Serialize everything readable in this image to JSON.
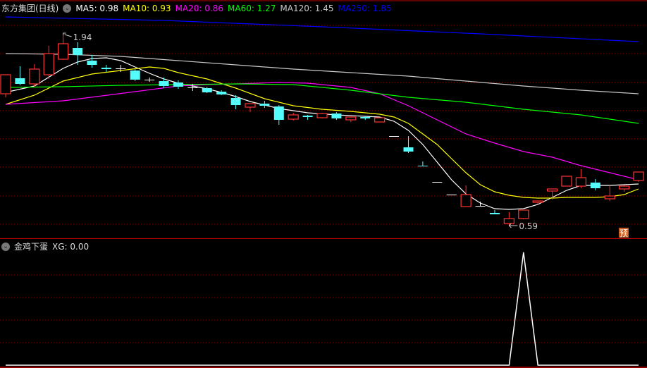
{
  "header": {
    "title": "东方集团(日线)",
    "ma_items": [
      {
        "label": "MA5: 0.98",
        "color": "#ffffff"
      },
      {
        "label": "MA10: 0.93",
        "color": "#ffff00"
      },
      {
        "label": "MA20: 0.86",
        "color": "#ff00ff"
      },
      {
        "label": "MA60: 1.27",
        "color": "#00ff00"
      },
      {
        "label": "MA120: 1.45",
        "color": "#c8c8c8"
      },
      {
        "label": "MA250: 1.85",
        "color": "#0000ff"
      }
    ]
  },
  "indicator": {
    "title": "金鸡下蛋",
    "value_label": "XG: 0.00"
  },
  "annotations": {
    "high_label": "1.94",
    "low_label": "0.59",
    "badge": "预"
  },
  "colors": {
    "up": "#ff3232",
    "down": "#54fcfc",
    "flat": "#ffffff",
    "grid": "#8b0000",
    "border": "#c00000"
  },
  "chart_data": [
    {
      "type": "candlestick",
      "title": "东方集团(日线)",
      "ylim": [
        0.5,
        2.19
      ],
      "ohlc": [
        [
          1.525,
          1.66,
          1.5,
          1.66
        ],
        [
          1.635,
          1.72,
          1.585,
          1.595
        ],
        [
          1.595,
          1.735,
          1.575,
          1.7
        ],
        [
          1.66,
          1.865,
          1.63,
          1.81
        ],
        [
          1.77,
          1.94,
          1.765,
          1.88
        ],
        [
          1.85,
          1.89,
          1.73,
          1.8
        ],
        [
          1.76,
          1.8,
          1.71,
          1.73
        ],
        [
          1.71,
          1.73,
          1.68,
          1.7
        ],
        [
          1.705,
          1.73,
          1.68,
          1.705
        ],
        [
          1.69,
          1.7,
          1.615,
          1.625
        ],
        [
          1.625,
          1.64,
          1.61,
          1.625
        ],
        [
          1.615,
          1.64,
          1.565,
          1.58
        ],
        [
          1.605,
          1.62,
          1.56,
          1.575
        ],
        [
          1.57,
          1.595,
          1.545,
          1.57
        ],
        [
          1.565,
          1.575,
          1.53,
          1.535
        ],
        [
          1.54,
          1.55,
          1.515,
          1.52
        ],
        [
          1.495,
          1.515,
          1.415,
          1.445
        ],
        [
          1.43,
          1.455,
          1.395,
          1.455
        ],
        [
          1.455,
          1.475,
          1.425,
          1.44
        ],
        [
          1.435,
          1.445,
          1.305,
          1.34
        ],
        [
          1.345,
          1.39,
          1.335,
          1.375
        ],
        [
          1.37,
          1.375,
          1.34,
          1.36
        ],
        [
          1.355,
          1.39,
          1.35,
          1.385
        ],
        [
          1.385,
          1.395,
          1.34,
          1.35
        ],
        [
          1.34,
          1.37,
          1.325,
          1.36
        ],
        [
          1.36,
          1.365,
          1.34,
          1.35
        ],
        [
          1.325,
          1.355,
          1.325,
          1.355
        ],
        [
          1.225,
          1.225,
          1.225,
          1.225
        ],
        [
          1.145,
          1.225,
          1.105,
          1.115
        ],
        [
          1.015,
          1.045,
          1.01,
          1.01
        ],
        [
          0.9,
          0.9,
          0.9,
          0.9
        ],
        [
          0.81,
          0.81,
          0.81,
          0.81
        ],
        [
          0.725,
          0.875,
          0.725,
          0.81
        ],
        [
          0.73,
          0.76,
          0.73,
          0.73
        ],
        [
          0.68,
          0.7,
          0.67,
          0.67
        ],
        [
          0.605,
          0.685,
          0.59,
          0.64
        ],
        [
          0.64,
          0.7,
          0.635,
          0.7
        ],
        [
          0.755,
          0.765,
          0.74,
          0.765
        ],
        [
          0.835,
          0.85,
          0.775,
          0.85
        ],
        [
          0.87,
          0.94,
          0.87,
          0.94
        ],
        [
          0.87,
          0.99,
          0.855,
          0.93
        ],
        [
          0.895,
          0.92,
          0.84,
          0.855
        ],
        [
          0.78,
          0.875,
          0.765,
          0.8
        ],
        [
          0.85,
          0.875,
          0.83,
          0.87
        ],
        [
          0.91,
          0.97,
          0.9,
          0.97
        ]
      ],
      "series": [
        {
          "name": "MA5",
          "color": "#ffffff",
          "points": [
            [
              1,
              1.535
            ],
            [
              3,
              1.58
            ],
            [
              5,
              1.705
            ],
            [
              6,
              1.75
            ],
            [
              7,
              1.775
            ],
            [
              8,
              1.78
            ],
            [
              9,
              1.76
            ],
            [
              10,
              1.715
            ],
            [
              11,
              1.67
            ],
            [
              12,
              1.63
            ],
            [
              13,
              1.6
            ],
            [
              14,
              1.58
            ],
            [
              15,
              1.56
            ],
            [
              16,
              1.535
            ],
            [
              17,
              1.505
            ],
            [
              18,
              1.47
            ],
            [
              19,
              1.445
            ],
            [
              20,
              1.42
            ],
            [
              22,
              1.39
            ],
            [
              24,
              1.375
            ],
            [
              26,
              1.365
            ],
            [
              27,
              1.36
            ],
            [
              28,
              1.33
            ],
            [
              29,
              1.265
            ],
            [
              30,
              1.165
            ],
            [
              31,
              1.04
            ],
            [
              32,
              0.915
            ],
            [
              33,
              0.815
            ],
            [
              34,
              0.75
            ],
            [
              35,
              0.71
            ],
            [
              36,
              0.705
            ],
            [
              37,
              0.71
            ],
            [
              38,
              0.74
            ],
            [
              39,
              0.79
            ],
            [
              40,
              0.84
            ],
            [
              41,
              0.875
            ],
            [
              42,
              0.875
            ],
            [
              43,
              0.875
            ],
            [
              44,
              0.88
            ],
            [
              45,
              0.885
            ]
          ]
        },
        {
          "name": "MA10",
          "color": "#ffff00",
          "points": [
            [
              1,
              1.45
            ],
            [
              3,
              1.515
            ],
            [
              5,
              1.615
            ],
            [
              7,
              1.665
            ],
            [
              9,
              1.69
            ],
            [
              11,
              1.715
            ],
            [
              12,
              1.705
            ],
            [
              13,
              1.675
            ],
            [
              15,
              1.63
            ],
            [
              17,
              1.565
            ],
            [
              19,
              1.49
            ],
            [
              21,
              1.44
            ],
            [
              23,
              1.415
            ],
            [
              25,
              1.4
            ],
            [
              27,
              1.38
            ],
            [
              28,
              1.36
            ],
            [
              29,
              1.315
            ],
            [
              30,
              1.24
            ],
            [
              31,
              1.165
            ],
            [
              32,
              1.065
            ],
            [
              33,
              0.965
            ],
            [
              34,
              0.88
            ],
            [
              35,
              0.83
            ],
            [
              36,
              0.805
            ],
            [
              37,
              0.79
            ],
            [
              38,
              0.785
            ],
            [
              39,
              0.785
            ],
            [
              40,
              0.79
            ],
            [
              41,
              0.79
            ],
            [
              42,
              0.79
            ],
            [
              43,
              0.795
            ],
            [
              44,
              0.81
            ],
            [
              45,
              0.85
            ]
          ]
        },
        {
          "name": "MA20",
          "color": "#ff00ff",
          "points": [
            [
              1,
              1.45
            ],
            [
              5,
              1.475
            ],
            [
              10,
              1.54
            ],
            [
              13,
              1.58
            ],
            [
              15,
              1.59
            ],
            [
              17,
              1.595
            ],
            [
              20,
              1.605
            ],
            [
              22,
              1.6
            ],
            [
              25,
              1.57
            ],
            [
              27,
              1.525
            ],
            [
              29,
              1.44
            ],
            [
              31,
              1.34
            ],
            [
              33,
              1.24
            ],
            [
              35,
              1.175
            ],
            [
              37,
              1.115
            ],
            [
              39,
              1.075
            ],
            [
              41,
              1.015
            ],
            [
              43,
              0.965
            ],
            [
              45,
              0.915
            ]
          ]
        },
        {
          "name": "MA60",
          "color": "#00ff00",
          "points": [
            [
              1,
              1.57
            ],
            [
              5,
              1.575
            ],
            [
              9,
              1.585
            ],
            [
              13,
              1.59
            ],
            [
              17,
              1.595
            ],
            [
              21,
              1.59
            ],
            [
              25,
              1.55
            ],
            [
              29,
              1.5
            ],
            [
              33,
              1.465
            ],
            [
              37,
              1.415
            ],
            [
              41,
              1.375
            ],
            [
              45,
              1.315
            ]
          ]
        },
        {
          "name": "MA120",
          "color": "#c8c8c8",
          "points": [
            [
              1,
              1.81
            ],
            [
              5,
              1.805
            ],
            [
              9,
              1.79
            ],
            [
              13,
              1.76
            ],
            [
              17,
              1.73
            ],
            [
              21,
              1.7
            ],
            [
              25,
              1.675
            ],
            [
              29,
              1.65
            ],
            [
              33,
              1.615
            ],
            [
              37,
              1.58
            ],
            [
              41,
              1.55
            ],
            [
              45,
              1.525
            ]
          ]
        },
        {
          "name": "MA250",
          "color": "#0000ff",
          "points": [
            [
              1,
              2.07
            ],
            [
              12,
              2.045
            ],
            [
              23,
              2.0
            ],
            [
              34,
              1.95
            ],
            [
              45,
              1.895
            ]
          ]
        }
      ]
    },
    {
      "type": "line",
      "title": "金鸡下蛋",
      "ylim": [
        0,
        1
      ],
      "series": [
        {
          "name": "XG",
          "color": "#ffffff",
          "values": [
            0,
            0,
            0,
            0,
            0,
            0,
            0,
            0,
            0,
            0,
            0,
            0,
            0,
            0,
            0,
            0,
            0,
            0,
            0,
            0,
            0,
            0,
            0,
            0,
            0,
            0,
            0,
            0,
            0,
            0,
            0,
            0,
            0,
            0,
            0,
            0,
            1,
            0,
            0,
            0,
            0,
            0,
            0,
            0,
            0
          ]
        }
      ]
    }
  ]
}
